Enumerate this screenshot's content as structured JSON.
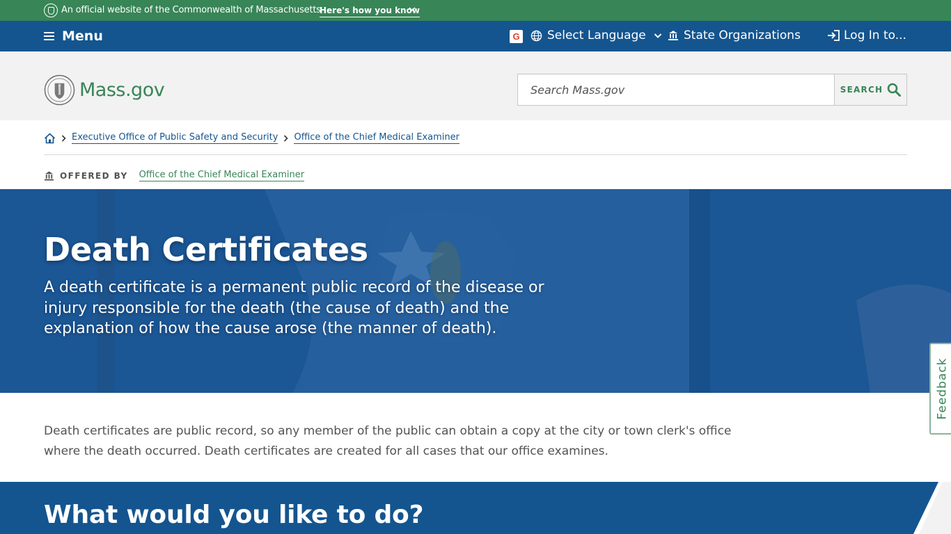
{
  "official_bar": {
    "text": "An official website of the Commonwealth of Massachusetts",
    "link": "Here's how you know"
  },
  "util_nav": {
    "menu": "Menu",
    "language": "Select Language",
    "state_orgs": "State Organizations",
    "login": "Log In to..."
  },
  "header": {
    "logo_text": "Mass.gov",
    "search_placeholder": "Search Mass.gov",
    "search_button": "SEARCH"
  },
  "breadcrumb": {
    "items": [
      "Executive Office of Public Safety and Security",
      "Office of the Chief Medical Examiner"
    ]
  },
  "offered_by": {
    "label": "OFFERED BY",
    "org": "Office of the Chief Medical Examiner"
  },
  "hero": {
    "title": "Death Certificates",
    "description": "A death certificate is a permanent public record of the disease or injury responsible for the death (the cause of death) and the explanation of how the cause arose (the manner of death)."
  },
  "feedback": "Feedback",
  "intro": "Death certificates are public record, so any member of the public can obtain a copy at the city or town clerk's office where the death occurred. Death certificates are created for all cases that our office examines.",
  "section": {
    "title": "What would you like to do?"
  },
  "colors": {
    "green": "#388557",
    "blue": "#14558f",
    "header_gray": "#f2f2f2"
  },
  "icons": [
    "seal-icon",
    "chevron-down-icon",
    "hamburger-icon",
    "google-icon",
    "globe-icon",
    "building-icon",
    "login-icon",
    "search-icon",
    "home-icon",
    "chevron-right-icon"
  ]
}
